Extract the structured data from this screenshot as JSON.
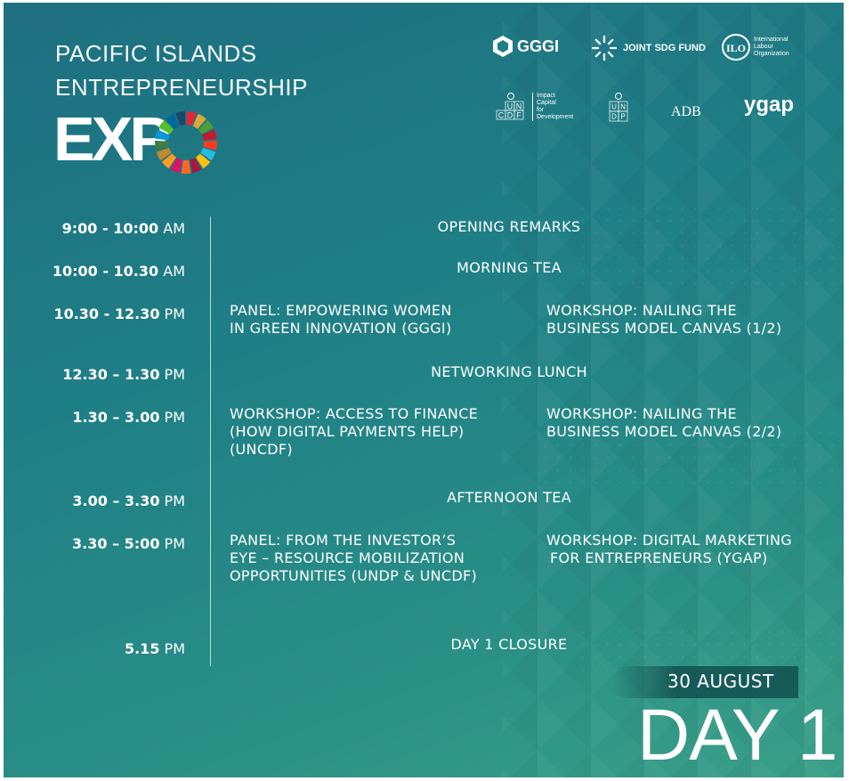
{
  "header": {
    "title_line1": "PACIFIC ISLANDS",
    "title_line2": "ENTREPRENEURSHIP",
    "title_expo": "EXP"
  },
  "logos": {
    "gggi": "GGGI",
    "joint_sdg_fund": "JOINT SDG FUND",
    "ilo_line1": "International",
    "ilo_line2": "Labour",
    "ilo_line3": "Organization",
    "uncdf_line1": "Impact",
    "uncdf_line2": "Capital",
    "uncdf_line3": "for",
    "uncdf_line4": "Development",
    "adb": "ADB",
    "ygap": "ygap"
  },
  "schedule": [
    {
      "time_bold": "9:00 - 10:00",
      "time_unit": " AM",
      "event": "OPENING REMARKS"
    },
    {
      "time_bold": "10:00 - 10.30",
      "time_unit": " AM",
      "event": "MORNING TEA"
    },
    {
      "time_bold": "10.30 - 12.30",
      "time_unit": " PM",
      "left_lines": [
        "PANEL: EMPOWERING WOMEN",
        "IN GREEN INNOVATION (GGGI)"
      ],
      "right_lines": [
        "WORKSHOP: NAILING THE",
        "BUSINESS MODEL CANVAS (1/2)"
      ]
    },
    {
      "time_bold": "12.30 – 1.30",
      "time_unit": " PM",
      "event": "NETWORKING LUNCH"
    },
    {
      "time_bold": "1.30 – 3.00",
      "time_unit": " PM",
      "left_lines": [
        "WORKSHOP: ACCESS TO FINANCE",
        "(HOW DIGITAL PAYMENTS HELP)",
        "(UNCDF)"
      ],
      "right_lines": [
        "WORKSHOP: NAILING THE",
        "BUSINESS MODEL CANVAS (2/2)"
      ]
    },
    {
      "time_bold": "3.00 – 3.30",
      "time_unit": " PM",
      "event": "AFTERNOON TEA"
    },
    {
      "time_bold": "3.30 – 5:00",
      "time_unit": " PM",
      "left_lines": [
        "PANEL: FROM THE INVESTOR’S",
        "EYE – RESOURCE MOBILIZATION",
        "OPPORTUNITIES (UNDP & UNCDF)"
      ],
      "right_lines": [
        "WORKSHOP: DIGITAL MARKETING",
        "FOR ENTREPRENEURS (YGAP)"
      ]
    },
    {
      "time_bold": "5.15",
      "time_unit": " PM",
      "event": "DAY 1 CLOSURE"
    }
  ],
  "footer": {
    "date": "30 AUGUST",
    "day": "DAY 1"
  },
  "colors": {
    "background_top": "#1e6f80",
    "background_bottom": "#3aa088",
    "text": "#ffffff",
    "date_pill": "#12504f"
  }
}
